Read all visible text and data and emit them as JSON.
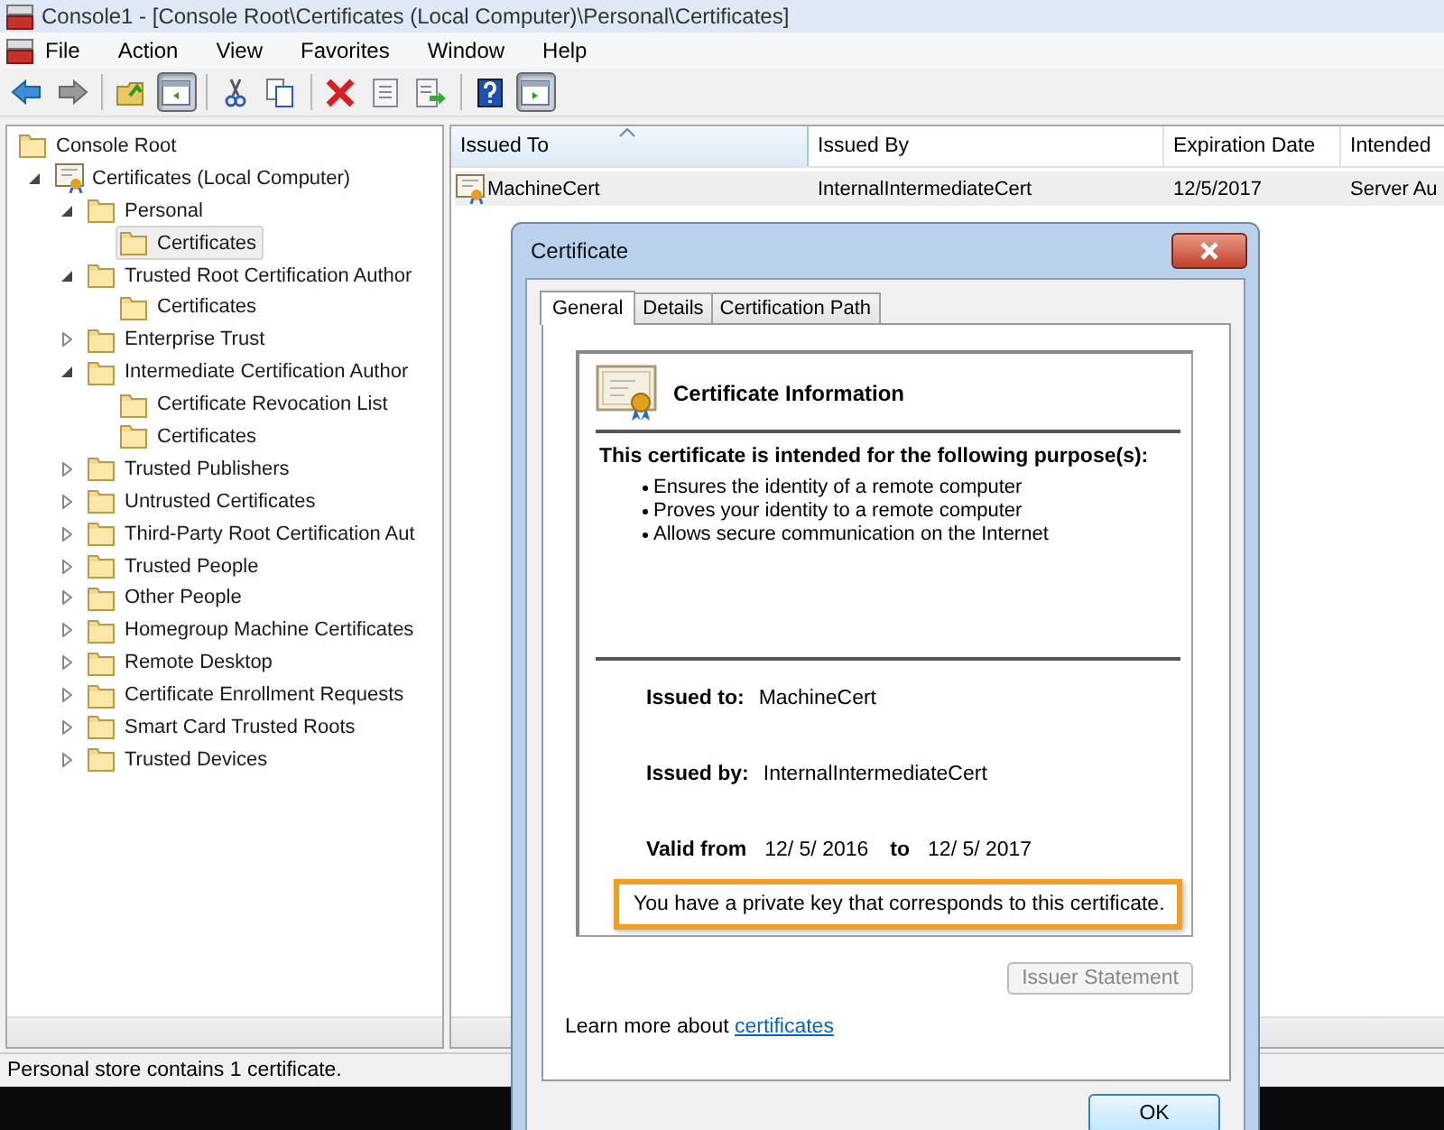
{
  "window": {
    "title": "Console1 - [Console Root\\Certificates (Local Computer)\\Personal\\Certificates]"
  },
  "menu": [
    "File",
    "Action",
    "View",
    "Favorites",
    "Window",
    "Help"
  ],
  "toolbar": [
    {
      "kind": "back",
      "pressed": false
    },
    {
      "kind": "forward",
      "pressed": false
    },
    {
      "kind": "separator"
    },
    {
      "kind": "up",
      "pressed": false
    },
    {
      "kind": "pane",
      "pressed": true
    },
    {
      "kind": "separator"
    },
    {
      "kind": "cut",
      "pressed": false
    },
    {
      "kind": "copy",
      "pressed": false
    },
    {
      "kind": "separator"
    },
    {
      "kind": "delete",
      "pressed": false
    },
    {
      "kind": "properties",
      "pressed": false
    },
    {
      "kind": "export",
      "pressed": false
    },
    {
      "kind": "separator"
    },
    {
      "kind": "help",
      "pressed": false
    },
    {
      "kind": "action-pane",
      "pressed": true
    }
  ],
  "tree": [
    {
      "label": "Console Root",
      "kind": "folder",
      "selected": false,
      "children": [
        {
          "label": "Certificates (Local Computer)",
          "kind": "store",
          "selected": false,
          "expanded": true,
          "children": [
            {
              "label": "Personal",
              "kind": "folder",
              "selected": false,
              "expanded": true,
              "children": [
                {
                  "label": "Certificates",
                  "kind": "folder",
                  "selected": true
                }
              ]
            },
            {
              "label": "Trusted Root Certification Author",
              "kind": "folder",
              "selected": false,
              "expanded": true,
              "children": [
                {
                  "label": "Certificates",
                  "kind": "folder",
                  "selected": false
                }
              ]
            },
            {
              "label": "Enterprise Trust",
              "kind": "folder",
              "selected": false,
              "expanded": false
            },
            {
              "label": "Intermediate Certification Author",
              "kind": "folder",
              "selected": false,
              "expanded": true,
              "children": [
                {
                  "label": "Certificate Revocation List",
                  "kind": "folder",
                  "selected": false
                },
                {
                  "label": "Certificates",
                  "kind": "folder",
                  "selected": false
                }
              ]
            },
            {
              "label": "Trusted Publishers",
              "kind": "folder",
              "selected": false,
              "expanded": false
            },
            {
              "label": "Untrusted Certificates",
              "kind": "folder",
              "selected": false,
              "expanded": false
            },
            {
              "label": "Third-Party Root Certification Aut",
              "kind": "folder",
              "selected": false,
              "expanded": false
            },
            {
              "label": "Trusted People",
              "kind": "folder",
              "selected": false,
              "expanded": false
            },
            {
              "label": "Other People",
              "kind": "folder",
              "selected": false,
              "expanded": false
            },
            {
              "label": "Homegroup Machine Certificates",
              "kind": "folder",
              "selected": false,
              "expanded": false
            },
            {
              "label": "Remote Desktop",
              "kind": "folder",
              "selected": false,
              "expanded": false
            },
            {
              "label": "Certificate Enrollment Requests",
              "kind": "folder",
              "selected": false,
              "expanded": false
            },
            {
              "label": "Smart Card Trusted Roots",
              "kind": "folder",
              "selected": false,
              "expanded": false
            },
            {
              "label": "Trusted Devices",
              "kind": "folder",
              "selected": false,
              "expanded": false
            }
          ]
        }
      ]
    }
  ],
  "list": {
    "columns": [
      {
        "label": "Issued To",
        "sorted": true
      },
      {
        "label": "Issued By",
        "sorted": false
      },
      {
        "label": "Expiration Date",
        "sorted": false
      },
      {
        "label": "Intended",
        "sorted": false
      }
    ],
    "rows": [
      {
        "cells": [
          "MachineCert",
          "InternalIntermediateCert",
          "12/5/2017",
          "Server Au"
        ],
        "selected": true
      }
    ]
  },
  "status_bar": "Personal store contains 1 certificate.",
  "dialog": {
    "title": "Certificate",
    "tabs": [
      {
        "label": "General",
        "selected": true
      },
      {
        "label": "Details",
        "selected": false
      },
      {
        "label": "Certification Path",
        "selected": false
      }
    ],
    "heading": "Certificate Information",
    "purpose_title": "This certificate is intended for the following purpose(s):",
    "purposes": [
      "Ensures the identity of a remote computer",
      "Proves your identity to a remote computer",
      "Allows secure communication on the Internet"
    ],
    "issued_to_label": "Issued to:",
    "issued_to": "MachineCert",
    "issued_by_label": "Issued by:",
    "issued_by": "InternalIntermediateCert",
    "valid_from_label": "Valid from",
    "valid_from": "12/ 5/ 2016",
    "to_label": "to",
    "valid_to": "12/ 5/ 2017",
    "key_note": {
      "text": "You have a private key that corresponds to this certificate.",
      "highlighted": true
    },
    "issuer_statement": {
      "label": "Issuer Statement",
      "disabled": true
    },
    "learn_more": "Learn more about",
    "learn_more_link": "certificates",
    "ok": "OK"
  }
}
